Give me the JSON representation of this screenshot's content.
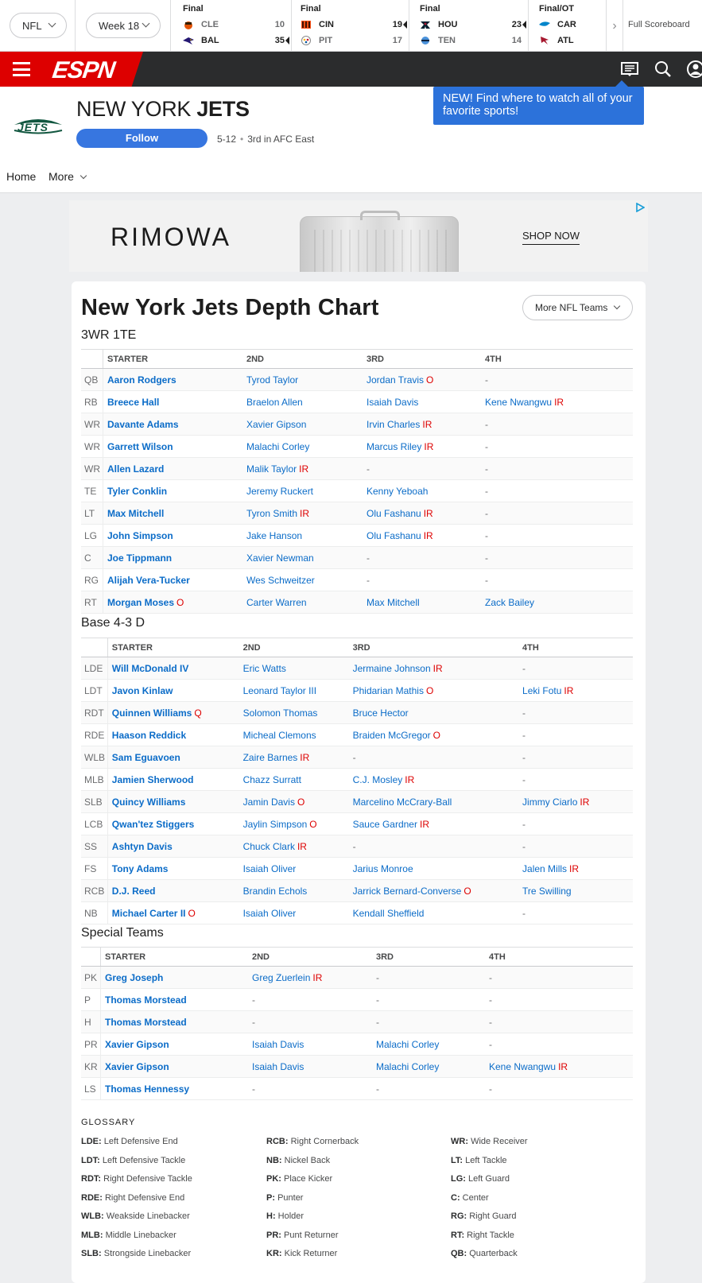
{
  "scoreboard": {
    "league_select": "NFL",
    "week_select": "Week 18",
    "games": [
      {
        "status": "Final",
        "team1": {
          "abbr": "CLE",
          "score": "10",
          "winner": false
        },
        "team2": {
          "abbr": "BAL",
          "score": "35",
          "winner": true
        }
      },
      {
        "status": "Final",
        "team1": {
          "abbr": "CIN",
          "score": "19",
          "winner": true
        },
        "team2": {
          "abbr": "PIT",
          "score": "17",
          "winner": false
        }
      },
      {
        "status": "Final",
        "team1": {
          "abbr": "HOU",
          "score": "23",
          "winner": true
        },
        "team2": {
          "abbr": "TEN",
          "score": "14",
          "winner": false
        }
      },
      {
        "status": "Final/OT",
        "team1": {
          "abbr": "CAR",
          "score": "",
          "winner": false
        },
        "team2": {
          "abbr": "ATL",
          "score": "",
          "winner": false
        }
      }
    ],
    "full_scoreboard_label": "Full Scoreboard"
  },
  "nav": {
    "logo_text": "ESPN",
    "promo": "NEW! Find where to watch all of your favorite sports!"
  },
  "team": {
    "name_prefix": "NEW YORK",
    "name_bold": "JETS",
    "follow_label": "Follow",
    "record": "5-12",
    "standing": "3rd in AFC East",
    "subnav_home": "Home",
    "subnav_more": "More"
  },
  "ad": {
    "brand": "RIMOWA",
    "cta": "SHOP NOW"
  },
  "page": {
    "title": "New York Jets Depth Chart",
    "more_teams_label": "More NFL Teams"
  },
  "colors": {
    "accent": "#0b6cc8",
    "espn_red": "#dd0000",
    "injury_red": "#dd0000",
    "follow_blue": "#3776e0",
    "jets_green": "#125740"
  },
  "offense": {
    "title": "3WR 1TE",
    "headers": [
      "STARTER",
      "2ND",
      "3RD",
      "4TH"
    ],
    "rows": [
      {
        "pos": "QB",
        "players": [
          [
            "Aaron Rodgers",
            ""
          ],
          [
            "Tyrod Taylor",
            ""
          ],
          [
            "Jordan Travis",
            "O"
          ],
          [
            "-",
            ""
          ]
        ]
      },
      {
        "pos": "RB",
        "players": [
          [
            "Breece Hall",
            ""
          ],
          [
            "Braelon Allen",
            ""
          ],
          [
            "Isaiah Davis",
            ""
          ],
          [
            "Kene Nwangwu",
            "IR"
          ]
        ]
      },
      {
        "pos": "WR",
        "players": [
          [
            "Davante Adams",
            ""
          ],
          [
            "Xavier Gipson",
            ""
          ],
          [
            "Irvin Charles",
            "IR"
          ],
          [
            "-",
            ""
          ]
        ]
      },
      {
        "pos": "WR",
        "players": [
          [
            "Garrett Wilson",
            ""
          ],
          [
            "Malachi Corley",
            ""
          ],
          [
            "Marcus Riley",
            "IR"
          ],
          [
            "-",
            ""
          ]
        ]
      },
      {
        "pos": "WR",
        "players": [
          [
            "Allen Lazard",
            ""
          ],
          [
            "Malik Taylor",
            "IR"
          ],
          [
            "-",
            ""
          ],
          [
            "-",
            ""
          ]
        ]
      },
      {
        "pos": "TE",
        "players": [
          [
            "Tyler Conklin",
            ""
          ],
          [
            "Jeremy Ruckert",
            ""
          ],
          [
            "Kenny Yeboah",
            ""
          ],
          [
            "-",
            ""
          ]
        ]
      },
      {
        "pos": "LT",
        "players": [
          [
            "Max Mitchell",
            ""
          ],
          [
            "Tyron Smith",
            "IR"
          ],
          [
            "Olu Fashanu",
            "IR"
          ],
          [
            "-",
            ""
          ]
        ]
      },
      {
        "pos": "LG",
        "players": [
          [
            "John Simpson",
            ""
          ],
          [
            "Jake Hanson",
            ""
          ],
          [
            "Olu Fashanu",
            "IR"
          ],
          [
            "-",
            ""
          ]
        ]
      },
      {
        "pos": "C",
        "players": [
          [
            "Joe Tippmann",
            ""
          ],
          [
            "Xavier Newman",
            ""
          ],
          [
            "-",
            ""
          ],
          [
            "-",
            ""
          ]
        ]
      },
      {
        "pos": "RG",
        "players": [
          [
            "Alijah Vera-Tucker",
            ""
          ],
          [
            "Wes Schweitzer",
            ""
          ],
          [
            "-",
            ""
          ],
          [
            "-",
            ""
          ]
        ]
      },
      {
        "pos": "RT",
        "players": [
          [
            "Morgan Moses",
            "O"
          ],
          [
            "Carter Warren",
            ""
          ],
          [
            "Max Mitchell",
            ""
          ],
          [
            "Zack Bailey",
            ""
          ]
        ]
      }
    ]
  },
  "defense": {
    "title": "Base 4-3 D",
    "headers": [
      "STARTER",
      "2ND",
      "3RD",
      "4TH"
    ],
    "rows": [
      {
        "pos": "LDE",
        "players": [
          [
            "Will McDonald IV",
            ""
          ],
          [
            "Eric Watts",
            ""
          ],
          [
            "Jermaine Johnson",
            "IR"
          ],
          [
            "-",
            ""
          ]
        ]
      },
      {
        "pos": "LDT",
        "players": [
          [
            "Javon Kinlaw",
            ""
          ],
          [
            "Leonard Taylor III",
            ""
          ],
          [
            "Phidarian Mathis",
            "O"
          ],
          [
            "Leki Fotu",
            "IR"
          ]
        ]
      },
      {
        "pos": "RDT",
        "players": [
          [
            "Quinnen Williams",
            "Q"
          ],
          [
            "Solomon Thomas",
            ""
          ],
          [
            "Bruce Hector",
            ""
          ],
          [
            "-",
            ""
          ]
        ]
      },
      {
        "pos": "RDE",
        "players": [
          [
            "Haason Reddick",
            ""
          ],
          [
            "Micheal Clemons",
            ""
          ],
          [
            "Braiden McGregor",
            "O"
          ],
          [
            "-",
            ""
          ]
        ]
      },
      {
        "pos": "WLB",
        "players": [
          [
            "Sam Eguavoen",
            ""
          ],
          [
            "Zaire Barnes",
            "IR"
          ],
          [
            "-",
            ""
          ],
          [
            "-",
            ""
          ]
        ]
      },
      {
        "pos": "MLB",
        "players": [
          [
            "Jamien Sherwood",
            ""
          ],
          [
            "Chazz Surratt",
            ""
          ],
          [
            "C.J. Mosley",
            "IR"
          ],
          [
            "-",
            ""
          ]
        ]
      },
      {
        "pos": "SLB",
        "players": [
          [
            "Quincy Williams",
            ""
          ],
          [
            "Jamin Davis",
            "O"
          ],
          [
            "Marcelino McCrary-Ball",
            ""
          ],
          [
            "Jimmy Ciarlo",
            "IR"
          ]
        ]
      },
      {
        "pos": "LCB",
        "players": [
          [
            "Qwan'tez Stiggers",
            ""
          ],
          [
            "Jaylin Simpson",
            "O"
          ],
          [
            "Sauce Gardner",
            "IR"
          ],
          [
            "-",
            ""
          ]
        ]
      },
      {
        "pos": "SS",
        "players": [
          [
            "Ashtyn Davis",
            ""
          ],
          [
            "Chuck Clark",
            "IR"
          ],
          [
            "-",
            ""
          ],
          [
            "-",
            ""
          ]
        ]
      },
      {
        "pos": "FS",
        "players": [
          [
            "Tony Adams",
            ""
          ],
          [
            "Isaiah Oliver",
            ""
          ],
          [
            "Jarius Monroe",
            ""
          ],
          [
            "Jalen Mills",
            "IR"
          ]
        ]
      },
      {
        "pos": "RCB",
        "players": [
          [
            "D.J. Reed",
            ""
          ],
          [
            "Brandin Echols",
            ""
          ],
          [
            "Jarrick Bernard-Converse",
            "O"
          ],
          [
            "Tre Swilling",
            ""
          ]
        ]
      },
      {
        "pos": "NB",
        "players": [
          [
            "Michael Carter II",
            "O"
          ],
          [
            "Isaiah Oliver",
            ""
          ],
          [
            "Kendall Sheffield",
            ""
          ],
          [
            "-",
            ""
          ]
        ]
      }
    ]
  },
  "special": {
    "title": "Special Teams",
    "headers": [
      "STARTER",
      "2ND",
      "3RD",
      "4TH"
    ],
    "rows": [
      {
        "pos": "PK",
        "players": [
          [
            "Greg Joseph",
            ""
          ],
          [
            "Greg Zuerlein",
            "IR"
          ],
          [
            "-",
            ""
          ],
          [
            "-",
            ""
          ]
        ]
      },
      {
        "pos": "P",
        "players": [
          [
            "Thomas Morstead",
            ""
          ],
          [
            "-",
            ""
          ],
          [
            "-",
            ""
          ],
          [
            "-",
            ""
          ]
        ]
      },
      {
        "pos": "H",
        "players": [
          [
            "Thomas Morstead",
            ""
          ],
          [
            "-",
            ""
          ],
          [
            "-",
            ""
          ],
          [
            "-",
            ""
          ]
        ]
      },
      {
        "pos": "PR",
        "players": [
          [
            "Xavier Gipson",
            ""
          ],
          [
            "Isaiah Davis",
            ""
          ],
          [
            "Malachi Corley",
            ""
          ],
          [
            "-",
            ""
          ]
        ]
      },
      {
        "pos": "KR",
        "players": [
          [
            "Xavier Gipson",
            ""
          ],
          [
            "Isaiah Davis",
            ""
          ],
          [
            "Malachi Corley",
            ""
          ],
          [
            "Kene Nwangwu",
            "IR"
          ]
        ]
      },
      {
        "pos": "LS",
        "players": [
          [
            "Thomas Hennessy",
            ""
          ],
          [
            "-",
            ""
          ],
          [
            "-",
            ""
          ],
          [
            "-",
            ""
          ]
        ]
      }
    ]
  },
  "glossary": {
    "title": "GLOSSARY",
    "col1": [
      {
        "abbr": "LDE:",
        "text": "Left Defensive End"
      },
      {
        "abbr": "LDT:",
        "text": "Left Defensive Tackle"
      },
      {
        "abbr": "RDT:",
        "text": "Right Defensive Tackle"
      },
      {
        "abbr": "RDE:",
        "text": "Right Defensive End"
      },
      {
        "abbr": "WLB:",
        "text": "Weakside Linebacker"
      },
      {
        "abbr": "MLB:",
        "text": "Middle Linebacker"
      },
      {
        "abbr": "SLB:",
        "text": "Strongside Linebacker"
      }
    ],
    "col2": [
      {
        "abbr": "RCB:",
        "text": "Right Cornerback"
      },
      {
        "abbr": "NB:",
        "text": "Nickel Back"
      },
      {
        "abbr": "PK:",
        "text": "Place Kicker"
      },
      {
        "abbr": "P:",
        "text": "Punter"
      },
      {
        "abbr": "H:",
        "text": "Holder"
      },
      {
        "abbr": "PR:",
        "text": "Punt Returner"
      },
      {
        "abbr": "KR:",
        "text": "Kick Returner"
      }
    ],
    "col3": [
      {
        "abbr": "WR:",
        "text": "Wide Receiver"
      },
      {
        "abbr": "LT:",
        "text": "Left Tackle"
      },
      {
        "abbr": "LG:",
        "text": "Left Guard"
      },
      {
        "abbr": "C:",
        "text": "Center"
      },
      {
        "abbr": "RG:",
        "text": "Right Guard"
      },
      {
        "abbr": "RT:",
        "text": "Right Tackle"
      },
      {
        "abbr": "QB:",
        "text": "Quarterback"
      }
    ]
  }
}
